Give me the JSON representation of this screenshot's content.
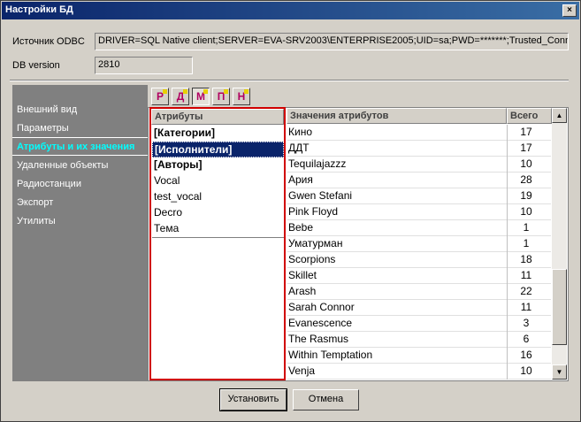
{
  "window": {
    "title": "Настройки БД",
    "close_glyph": "×"
  },
  "odbc": {
    "label": "Источник ODBC",
    "value": "DRIVER=SQL Native client;SERVER=EVA-SRV2003\\ENTERPRISE2005;UID=sa;PWD=*******;Trusted_Conne"
  },
  "db_version": {
    "label": "DB version",
    "value": "2810"
  },
  "sidebar": {
    "items": [
      {
        "label": "Внешний вид"
      },
      {
        "label": "Параметры"
      },
      {
        "label": "Атрибуты и их значения"
      },
      {
        "label": "Удаленные объекты"
      },
      {
        "label": "Радиостанции"
      },
      {
        "label": "Экспорт"
      },
      {
        "label": "Утилиты"
      }
    ],
    "active_index": 2
  },
  "tabs": [
    {
      "letter": "Р"
    },
    {
      "letter": "Д"
    },
    {
      "letter": "М"
    },
    {
      "letter": "П"
    },
    {
      "letter": "Н"
    }
  ],
  "attributes": {
    "header": "Атрибуты",
    "rows": [
      {
        "label": "[Категории]"
      },
      {
        "label": "[Исполнители]"
      },
      {
        "label": "[Авторы]"
      },
      {
        "label": "Vocal"
      },
      {
        "label": "test_vocal"
      },
      {
        "label": "Decro"
      },
      {
        "label": "Тема"
      }
    ],
    "selected_index": 1
  },
  "values": {
    "header_name": "Значения атрибутов",
    "header_count": "Всего",
    "rows": [
      {
        "name": "Кино",
        "count": "17"
      },
      {
        "name": "ДДТ",
        "count": "17"
      },
      {
        "name": "Tequilajazzz",
        "count": "10"
      },
      {
        "name": "Ария",
        "count": "28"
      },
      {
        "name": "Gwen Stefani",
        "count": "19"
      },
      {
        "name": "Pink Floyd",
        "count": "10"
      },
      {
        "name": "Bebe",
        "count": "1"
      },
      {
        "name": "Уматурман",
        "count": "1"
      },
      {
        "name": "Scorpions",
        "count": "18"
      },
      {
        "name": "Skillet",
        "count": "11"
      },
      {
        "name": "Arash",
        "count": "22"
      },
      {
        "name": "Sarah Connor",
        "count": "11"
      },
      {
        "name": "Evanescence",
        "count": "3"
      },
      {
        "name": "The Rasmus",
        "count": "6"
      },
      {
        "name": "Within Temptation",
        "count": "16"
      },
      {
        "name": "Venja",
        "count": "10"
      }
    ]
  },
  "scroll": {
    "up_glyph": "▲",
    "down_glyph": "▼"
  },
  "buttons": {
    "apply": "Установить",
    "cancel": "Отмена"
  }
}
